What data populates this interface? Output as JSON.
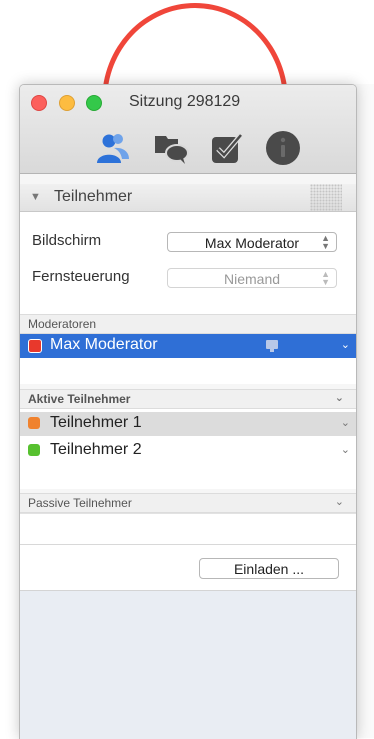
{
  "window": {
    "title": "Sitzung 298129"
  },
  "toolbar": {
    "icons": [
      "participants-icon",
      "chat-icon",
      "tasks-icon",
      "info-icon"
    ]
  },
  "panel": {
    "title": "Teilnehmer",
    "screen_label": "Bildschirm",
    "screen_value": "Max Moderator",
    "remote_label": "Fernsteuerung",
    "remote_value": "Niemand"
  },
  "sections": {
    "moderators": {
      "title": "Moderatoren",
      "items": [
        {
          "name": "Max Moderator",
          "status_color": "#e8382c"
        }
      ]
    },
    "active": {
      "title": "Aktive Teilnehmer",
      "items": [
        {
          "name": "Teilnehmer 1",
          "status_color": "#f0822e"
        },
        {
          "name": "Teilnehmer 2",
          "status_color": "#57c12f"
        }
      ]
    },
    "passive": {
      "title": "Passive Teilnehmer",
      "items": []
    }
  },
  "actions": {
    "invite_label": "Einladen ..."
  },
  "colors": {
    "selection": "#2f6fd6",
    "annotation": "#f0463a"
  }
}
